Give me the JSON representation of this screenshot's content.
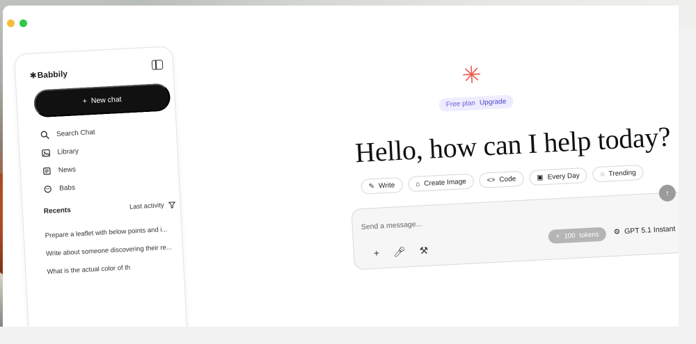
{
  "window": {
    "controls": [
      "yellow",
      "green"
    ]
  },
  "sidebar": {
    "brand": "Babbily",
    "new_chat_label": "New chat",
    "items": [
      {
        "label": "Search Chat",
        "icon": "search-icon"
      },
      {
        "label": "Library",
        "icon": "image-icon"
      },
      {
        "label": "News",
        "icon": "news-icon"
      },
      {
        "label": "Babs",
        "icon": "bot-icon"
      }
    ],
    "recents_title": "Recents",
    "recents_filter": "Last activity",
    "recents": [
      "Prepare a leaflet with below points and i...",
      "Write about someone discovering their re...",
      "What is the actual color of th"
    ]
  },
  "main": {
    "plan": "Free plan",
    "upgrade": "Upgrade",
    "headline": "Hello, how can I help today?",
    "chips": [
      {
        "label": "Write",
        "icon": "pencil-icon"
      },
      {
        "label": "Create Image",
        "icon": "image-icon"
      },
      {
        "label": "Code",
        "icon": "code-icon"
      },
      {
        "label": "Every Day",
        "icon": "calendar-icon"
      },
      {
        "label": "Trending",
        "icon": "bulb-icon"
      }
    ],
    "composer": {
      "placeholder": "Send a message...",
      "tokens": "100",
      "tokens_suffix": "tokens",
      "model": "GPT 5.1 Instant"
    }
  },
  "colors": {
    "accent": "#ef5a4f",
    "primary": "#111111",
    "plan_bg": "#eeecff",
    "plan_text": "#6a63d9"
  }
}
